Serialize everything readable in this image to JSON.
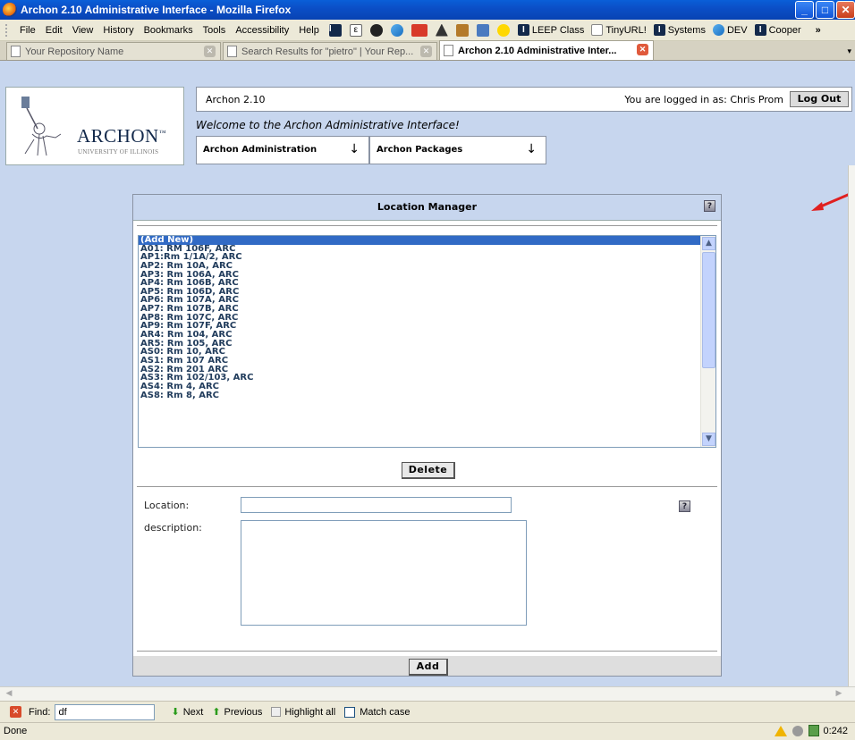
{
  "window": {
    "title": "Archon 2.10 Administrative Interface - Mozilla Firefox"
  },
  "menubar": {
    "items": [
      "File",
      "Edit",
      "View",
      "History",
      "Bookmarks",
      "Tools",
      "Accessibility",
      "Help"
    ],
    "bookmarks": [
      "LEEP Class",
      "TinyURL!",
      "Systems",
      "DEV",
      "Cooper"
    ],
    "overflow": "»"
  },
  "tabs": [
    {
      "label": "Your Repository Name"
    },
    {
      "label": "Search Results for \"pietro\" | Your Rep..."
    },
    {
      "label": "Archon 2.10 Administrative Inter..."
    }
  ],
  "header": {
    "logo_word": "ARCHON",
    "logo_tm": "™",
    "logo_sub": "UNIVERSITY OF ILLINOIS",
    "version": "Archon 2.10",
    "logged_in": "You are logged in as: Chris Prom",
    "logout_label": "Log Out",
    "welcome": "Welcome to the Archon Administrative Interface!",
    "packages": [
      {
        "label": "Archon Administration",
        "arrow": "↓"
      },
      {
        "label": "Archon Packages",
        "arrow": "↓"
      }
    ]
  },
  "location_manager": {
    "title": "Location Manager",
    "help": "?",
    "locations": [
      "(Add New)",
      "A01: RM 106F, ARC",
      "AP1:Rm 1/1A/2, ARC",
      "AP2: Rm 10A, ARC",
      "AP3: Rm 106A, ARC",
      "AP4: Rm 106B, ARC",
      "AP5: Rm 106D, ARC",
      "AP6: Rm 107A, ARC",
      "AP7: Rm 107B, ARC",
      "AP8: Rm 107C, ARC",
      "AP9: Rm 107F, ARC",
      "AR4: Rm 104, ARC",
      "AR5: Rm 105, ARC",
      "AS0: Rm 10, ARC",
      "AS1: Rm 107 ARC",
      "AS2: Rm 201 ARC",
      "AS3: Rm 102/103, ARC",
      "AS4: Rm 4, ARC",
      "AS8: Rm 8, ARC"
    ],
    "selected_index": 0,
    "delete_label": "Delete",
    "location_label": "Location:",
    "location_value": "",
    "description_label": "description:",
    "description_value": "",
    "add_label": "Add"
  },
  "findbar": {
    "label": "Find:",
    "value": "df",
    "next": "Next",
    "previous": "Previous",
    "highlight": "Highlight all",
    "match_case": "Match case"
  },
  "statusbar": {
    "text": "Done",
    "time": "0:242"
  }
}
